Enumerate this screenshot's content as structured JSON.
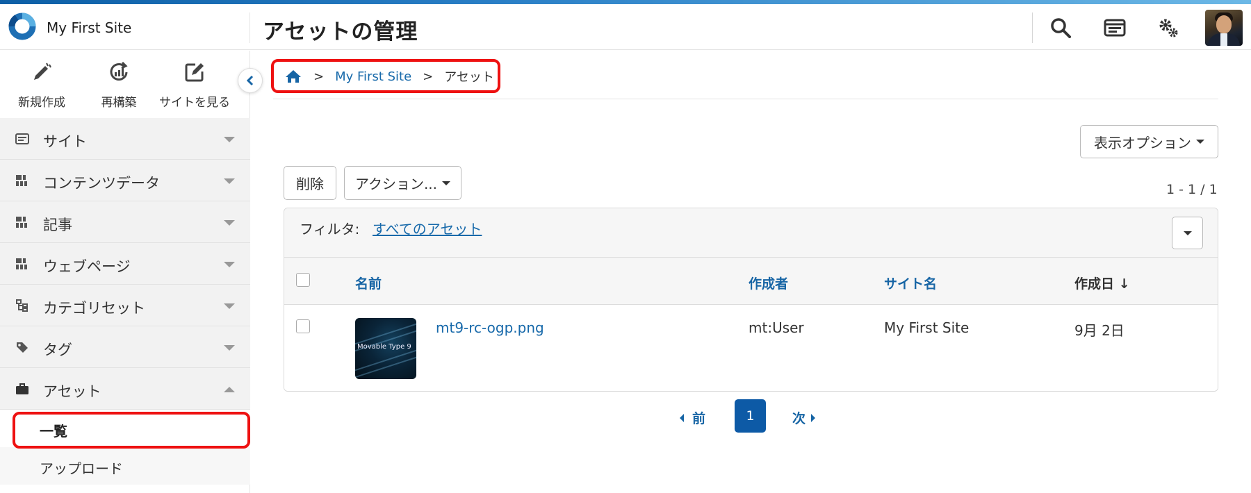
{
  "header": {
    "site_name": "My First Site",
    "page_title": "アセットの管理",
    "icons": [
      "search-icon",
      "dashboard-icon",
      "settings-icon",
      "avatar"
    ]
  },
  "sidebar": {
    "quick_actions": [
      {
        "label": "新規作成",
        "icon": "pen-icon"
      },
      {
        "label": "再構築",
        "icon": "rebuild-icon"
      },
      {
        "label": "サイトを見る",
        "icon": "external-edit-icon"
      }
    ],
    "menu": [
      {
        "label": "サイト",
        "icon": "site-icon",
        "expanded": false
      },
      {
        "label": "コンテンツデータ",
        "icon": "grid-icon",
        "expanded": false
      },
      {
        "label": "記事",
        "icon": "grid-icon",
        "expanded": false
      },
      {
        "label": "ウェブページ",
        "icon": "grid-icon",
        "expanded": false
      },
      {
        "label": "カテゴリセット",
        "icon": "tree-icon",
        "expanded": false
      },
      {
        "label": "タグ",
        "icon": "tag-icon",
        "expanded": false
      },
      {
        "label": "アセット",
        "icon": "briefcase-icon",
        "expanded": true
      }
    ],
    "asset_submenu": [
      {
        "label": "一覧",
        "active": true
      },
      {
        "label": "アップロード",
        "active": false
      }
    ]
  },
  "breadcrumb": {
    "separator": ">",
    "site": "My First Site",
    "current": "アセット"
  },
  "toolbar": {
    "display_options": "表示オプション",
    "delete": "削除",
    "actions": "アクション...",
    "count": "1 - 1 / 1"
  },
  "filter": {
    "label": "フィルタ:",
    "value": "すべてのアセット"
  },
  "table": {
    "columns": [
      "名前",
      "作成者",
      "サイト名",
      "作成日 ↓"
    ],
    "rows": [
      {
        "name": "mt9-rc-ogp.png",
        "author": "mt:User",
        "site": "My First Site",
        "date": "9月 2日",
        "thumb_text": "Movable Type 9"
      }
    ]
  },
  "pagination": {
    "prev": "前",
    "current": "1",
    "next": "次"
  },
  "colors": {
    "accent": "#1765a5",
    "highlight": "#ee1111",
    "active_page": "#0d5aa6"
  }
}
